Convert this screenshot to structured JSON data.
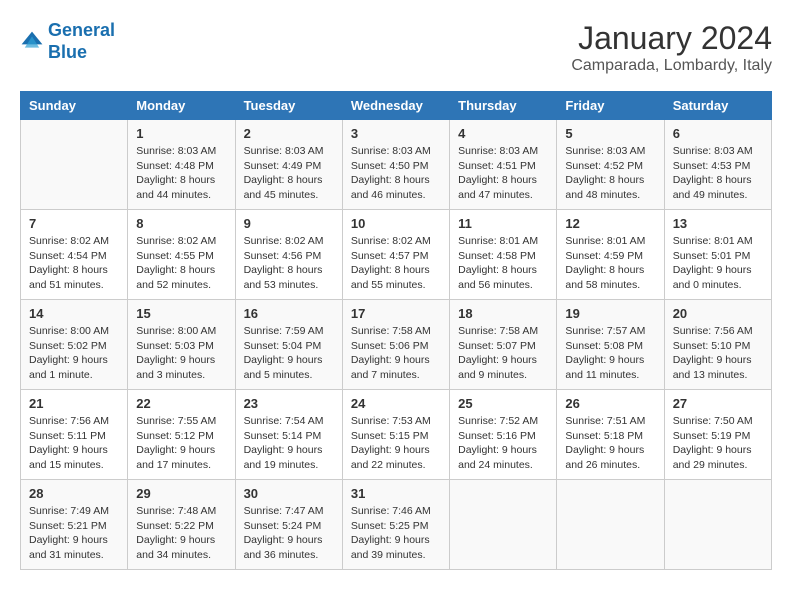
{
  "header": {
    "logo_line1": "General",
    "logo_line2": "Blue",
    "month": "January 2024",
    "location": "Camparada, Lombardy, Italy"
  },
  "weekdays": [
    "Sunday",
    "Monday",
    "Tuesday",
    "Wednesday",
    "Thursday",
    "Friday",
    "Saturday"
  ],
  "weeks": [
    [
      {
        "day": "",
        "info": ""
      },
      {
        "day": "1",
        "info": "Sunrise: 8:03 AM\nSunset: 4:48 PM\nDaylight: 8 hours\nand 44 minutes."
      },
      {
        "day": "2",
        "info": "Sunrise: 8:03 AM\nSunset: 4:49 PM\nDaylight: 8 hours\nand 45 minutes."
      },
      {
        "day": "3",
        "info": "Sunrise: 8:03 AM\nSunset: 4:50 PM\nDaylight: 8 hours\nand 46 minutes."
      },
      {
        "day": "4",
        "info": "Sunrise: 8:03 AM\nSunset: 4:51 PM\nDaylight: 8 hours\nand 47 minutes."
      },
      {
        "day": "5",
        "info": "Sunrise: 8:03 AM\nSunset: 4:52 PM\nDaylight: 8 hours\nand 48 minutes."
      },
      {
        "day": "6",
        "info": "Sunrise: 8:03 AM\nSunset: 4:53 PM\nDaylight: 8 hours\nand 49 minutes."
      }
    ],
    [
      {
        "day": "7",
        "info": "Sunrise: 8:02 AM\nSunset: 4:54 PM\nDaylight: 8 hours\nand 51 minutes."
      },
      {
        "day": "8",
        "info": "Sunrise: 8:02 AM\nSunset: 4:55 PM\nDaylight: 8 hours\nand 52 minutes."
      },
      {
        "day": "9",
        "info": "Sunrise: 8:02 AM\nSunset: 4:56 PM\nDaylight: 8 hours\nand 53 minutes."
      },
      {
        "day": "10",
        "info": "Sunrise: 8:02 AM\nSunset: 4:57 PM\nDaylight: 8 hours\nand 55 minutes."
      },
      {
        "day": "11",
        "info": "Sunrise: 8:01 AM\nSunset: 4:58 PM\nDaylight: 8 hours\nand 56 minutes."
      },
      {
        "day": "12",
        "info": "Sunrise: 8:01 AM\nSunset: 4:59 PM\nDaylight: 8 hours\nand 58 minutes."
      },
      {
        "day": "13",
        "info": "Sunrise: 8:01 AM\nSunset: 5:01 PM\nDaylight: 9 hours\nand 0 minutes."
      }
    ],
    [
      {
        "day": "14",
        "info": "Sunrise: 8:00 AM\nSunset: 5:02 PM\nDaylight: 9 hours\nand 1 minute."
      },
      {
        "day": "15",
        "info": "Sunrise: 8:00 AM\nSunset: 5:03 PM\nDaylight: 9 hours\nand 3 minutes."
      },
      {
        "day": "16",
        "info": "Sunrise: 7:59 AM\nSunset: 5:04 PM\nDaylight: 9 hours\nand 5 minutes."
      },
      {
        "day": "17",
        "info": "Sunrise: 7:58 AM\nSunset: 5:06 PM\nDaylight: 9 hours\nand 7 minutes."
      },
      {
        "day": "18",
        "info": "Sunrise: 7:58 AM\nSunset: 5:07 PM\nDaylight: 9 hours\nand 9 minutes."
      },
      {
        "day": "19",
        "info": "Sunrise: 7:57 AM\nSunset: 5:08 PM\nDaylight: 9 hours\nand 11 minutes."
      },
      {
        "day": "20",
        "info": "Sunrise: 7:56 AM\nSunset: 5:10 PM\nDaylight: 9 hours\nand 13 minutes."
      }
    ],
    [
      {
        "day": "21",
        "info": "Sunrise: 7:56 AM\nSunset: 5:11 PM\nDaylight: 9 hours\nand 15 minutes."
      },
      {
        "day": "22",
        "info": "Sunrise: 7:55 AM\nSunset: 5:12 PM\nDaylight: 9 hours\nand 17 minutes."
      },
      {
        "day": "23",
        "info": "Sunrise: 7:54 AM\nSunset: 5:14 PM\nDaylight: 9 hours\nand 19 minutes."
      },
      {
        "day": "24",
        "info": "Sunrise: 7:53 AM\nSunset: 5:15 PM\nDaylight: 9 hours\nand 22 minutes."
      },
      {
        "day": "25",
        "info": "Sunrise: 7:52 AM\nSunset: 5:16 PM\nDaylight: 9 hours\nand 24 minutes."
      },
      {
        "day": "26",
        "info": "Sunrise: 7:51 AM\nSunset: 5:18 PM\nDaylight: 9 hours\nand 26 minutes."
      },
      {
        "day": "27",
        "info": "Sunrise: 7:50 AM\nSunset: 5:19 PM\nDaylight: 9 hours\nand 29 minutes."
      }
    ],
    [
      {
        "day": "28",
        "info": "Sunrise: 7:49 AM\nSunset: 5:21 PM\nDaylight: 9 hours\nand 31 minutes."
      },
      {
        "day": "29",
        "info": "Sunrise: 7:48 AM\nSunset: 5:22 PM\nDaylight: 9 hours\nand 34 minutes."
      },
      {
        "day": "30",
        "info": "Sunrise: 7:47 AM\nSunset: 5:24 PM\nDaylight: 9 hours\nand 36 minutes."
      },
      {
        "day": "31",
        "info": "Sunrise: 7:46 AM\nSunset: 5:25 PM\nDaylight: 9 hours\nand 39 minutes."
      },
      {
        "day": "",
        "info": ""
      },
      {
        "day": "",
        "info": ""
      },
      {
        "day": "",
        "info": ""
      }
    ]
  ]
}
